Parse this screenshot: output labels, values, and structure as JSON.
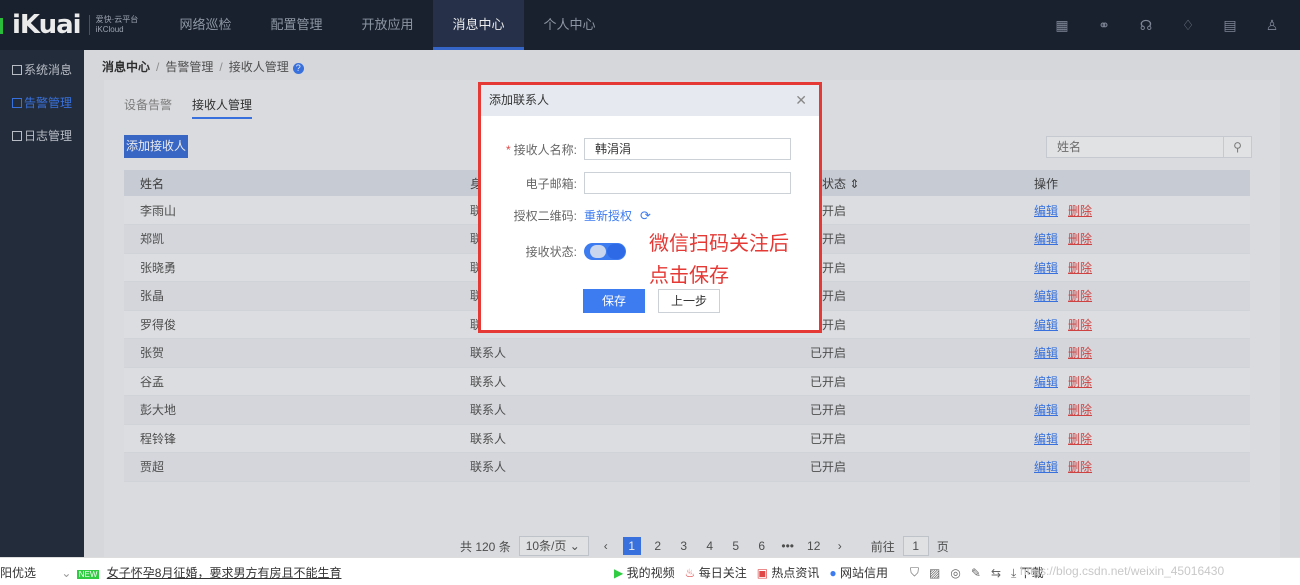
{
  "brand": {
    "logo": "iKuai",
    "sub1": "爱快·云平台",
    "sub2": "iKCloud"
  },
  "nav": [
    "网络巡检",
    "配置管理",
    "开放应用",
    "消息中心",
    "个人中心"
  ],
  "nav_active_index": 3,
  "sidebar": [
    {
      "label": "系统消息",
      "active": false
    },
    {
      "label": "告警管理",
      "active": true
    },
    {
      "label": "日志管理",
      "active": false
    }
  ],
  "breadcrumb": [
    "消息中心",
    "告警管理",
    "接收人管理"
  ],
  "tabs": [
    {
      "label": "设备告警",
      "active": false
    },
    {
      "label": "接收人管理",
      "active": true
    }
  ],
  "add_button": "添加接收人",
  "search": {
    "placeholder": "姓名"
  },
  "table": {
    "headers": [
      "姓名",
      "身",
      "收状态 ⇕",
      "操作"
    ],
    "rows": [
      [
        "李雨山",
        "联",
        "已开启"
      ],
      [
        "郑凯",
        "联",
        "已开启"
      ],
      [
        "张晓勇",
        "联",
        "已开启"
      ],
      [
        "张晶",
        "联",
        "已开启"
      ],
      [
        "罗得俊",
        "联",
        "已开启"
      ],
      [
        "张贺",
        "联系人",
        "已开启"
      ],
      [
        "谷孟",
        "联系人",
        "已开启"
      ],
      [
        "彭大地",
        "联系人",
        "已开启"
      ],
      [
        "程铃锋",
        "联系人",
        "已开启"
      ],
      [
        "贾超",
        "联系人",
        "已开启"
      ]
    ],
    "edit": "编辑",
    "delete": "删除"
  },
  "pager": {
    "total": "共 120 条",
    "size": "10条/页",
    "pages": [
      "1",
      "2",
      "3",
      "4",
      "5",
      "6",
      "•••",
      "12"
    ],
    "active": "1",
    "goto": "前往",
    "goto_value": "1",
    "page_unit": "页"
  },
  "modal": {
    "title": "添加联系人",
    "name_label": "接收人名称:",
    "name_value": "韩涓涓",
    "email_label": "电子邮箱:",
    "email_value": "",
    "qr_label": "授权二维码:",
    "reauth": "重新授权",
    "status_label": "接收状态:",
    "status_on": true,
    "annotation_line1": "微信扫码关注后",
    "annotation_line2": "点击保存",
    "save": "保存",
    "prev": "上一步"
  },
  "taskbar": {
    "left_prefix": "阳优选",
    "new_badge": "NEW",
    "headline": "女子怀孕8月征婚，要求男方有房且不能生育",
    "items": [
      "我的视频",
      "每日关注",
      "热点资讯",
      "网站信用"
    ],
    "download": "下载",
    "watermark": "https://blog.csdn.net/weixin_45016430"
  },
  "colors": {
    "accent": "#3d7bf0",
    "danger": "#e53935",
    "topbar": "#1c2433",
    "sidebar": "#27303f"
  }
}
